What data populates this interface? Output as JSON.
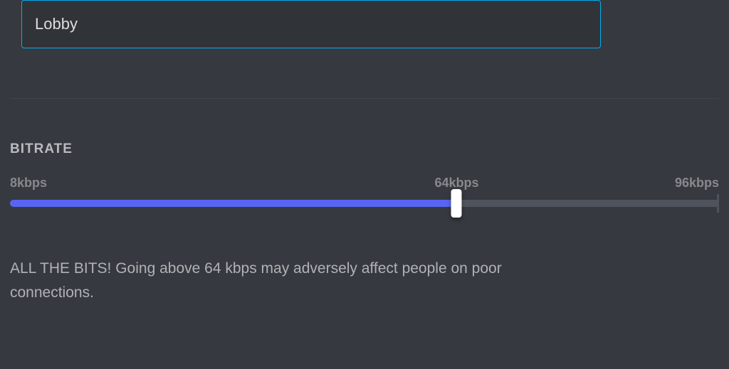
{
  "channel_name": {
    "value": "Lobby"
  },
  "bitrate": {
    "heading": "BITRATE",
    "labels": {
      "min": "8kbps",
      "mid": "64kbps",
      "max": "96kbps"
    },
    "slider": {
      "fill_percent": 63,
      "mid_percent": 63
    },
    "description": "ALL THE BITS! Going above 64 kbps may adversely affect people on poor connections."
  }
}
